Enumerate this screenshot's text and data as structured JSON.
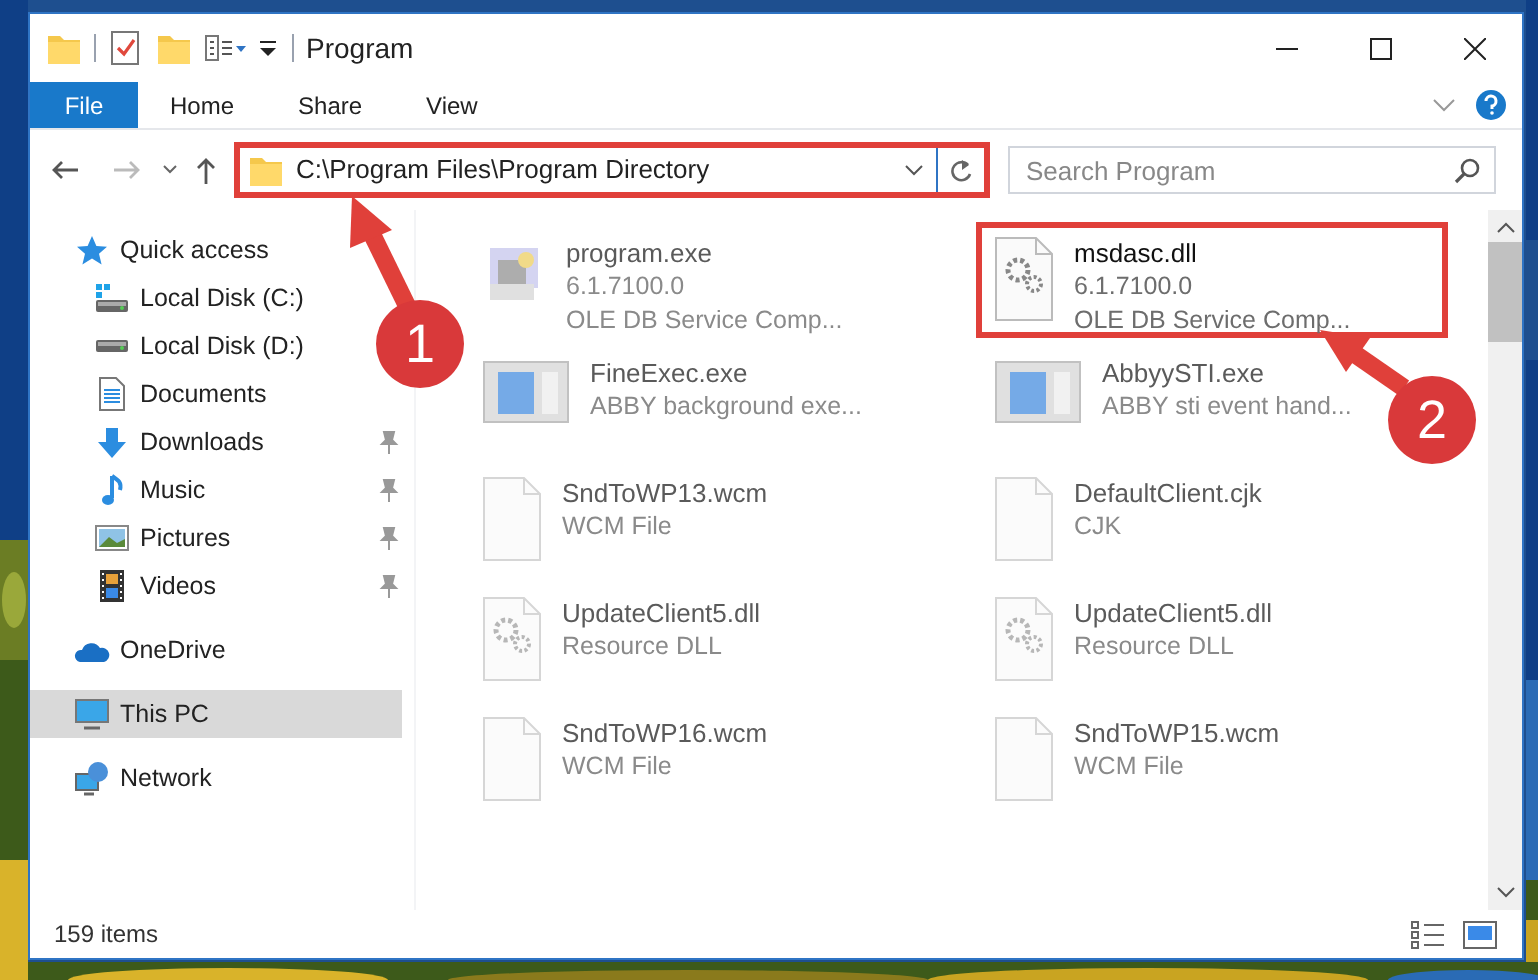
{
  "window": {
    "title": "Program"
  },
  "ribbon_tabs": [
    {
      "label": "File",
      "kind": "file"
    },
    {
      "label": "Home",
      "kind": "tab"
    },
    {
      "label": "Share",
      "kind": "tab"
    },
    {
      "label": "View",
      "kind": "tab"
    }
  ],
  "address_bar": {
    "path": "C:\\Program Files\\Program Directory",
    "highlighted": true
  },
  "search": {
    "placeholder": "Search Program"
  },
  "nav": [
    {
      "label": "Quick access",
      "kind": "star",
      "selected": false,
      "children": [
        {
          "label": "Local Disk (C:)",
          "kind": "disk-c",
          "pinned": false,
          "selected": false
        },
        {
          "label": "Local Disk (D:)",
          "kind": "disk",
          "pinned": false,
          "selected": false
        },
        {
          "label": "Documents",
          "kind": "documents",
          "pinned": false,
          "selected": false
        },
        {
          "label": "Downloads",
          "kind": "downloads",
          "pinned": true,
          "selected": false
        },
        {
          "label": "Music",
          "kind": "music",
          "pinned": true,
          "selected": false
        },
        {
          "label": "Pictures",
          "kind": "pictures",
          "pinned": true,
          "selected": false
        },
        {
          "label": "Videos",
          "kind": "videos",
          "pinned": true,
          "selected": false
        }
      ]
    },
    {
      "label": "OneDrive",
      "kind": "cloud",
      "selected": false
    },
    {
      "label": "This PC",
      "kind": "pc",
      "selected": true
    },
    {
      "label": "Network",
      "kind": "network",
      "selected": false
    }
  ],
  "files": [
    {
      "name": "program.exe",
      "details": [
        "6.1.7100.0",
        "OLE DB Service Comp..."
      ],
      "kind": "app",
      "blurred": true,
      "highlighted": false
    },
    {
      "name": "msdasc.dll",
      "details": [
        "6.1.7100.0",
        "OLE DB Service Comp..."
      ],
      "kind": "gear-doc",
      "blurred": false,
      "highlighted": true
    },
    {
      "name": "FineExec.exe",
      "details": [
        "ABBY background exe..."
      ],
      "kind": "window",
      "blurred": true,
      "highlighted": false
    },
    {
      "name": "AbbyySTI.exe",
      "details": [
        "ABBY sti event hand..."
      ],
      "kind": "window",
      "blurred": true,
      "highlighted": false
    },
    {
      "name": "SndToWP13.wcm",
      "details": [
        "WCM File"
      ],
      "kind": "doc",
      "blurred": true,
      "highlighted": false
    },
    {
      "name": "DefaultClient.cjk",
      "details": [
        "CJK"
      ],
      "kind": "doc",
      "blurred": true,
      "highlighted": false
    },
    {
      "name": "UpdateClient5.dll",
      "details": [
        "Resource DLL"
      ],
      "kind": "gear-doc",
      "blurred": true,
      "highlighted": false
    },
    {
      "name": "UpdateClient5.dll",
      "details": [
        "Resource DLL"
      ],
      "kind": "gear-doc",
      "blurred": true,
      "highlighted": false
    },
    {
      "name": "SndToWP16.wcm",
      "details": [
        "WCM File"
      ],
      "kind": "doc",
      "blurred": true,
      "highlighted": false
    },
    {
      "name": "SndToWP15.wcm",
      "details": [
        "WCM File"
      ],
      "kind": "doc",
      "blurred": true,
      "highlighted": false
    }
  ],
  "status_bar": {
    "item_count": "159 items"
  },
  "callouts": [
    {
      "label": "1"
    },
    {
      "label": "2"
    }
  ]
}
